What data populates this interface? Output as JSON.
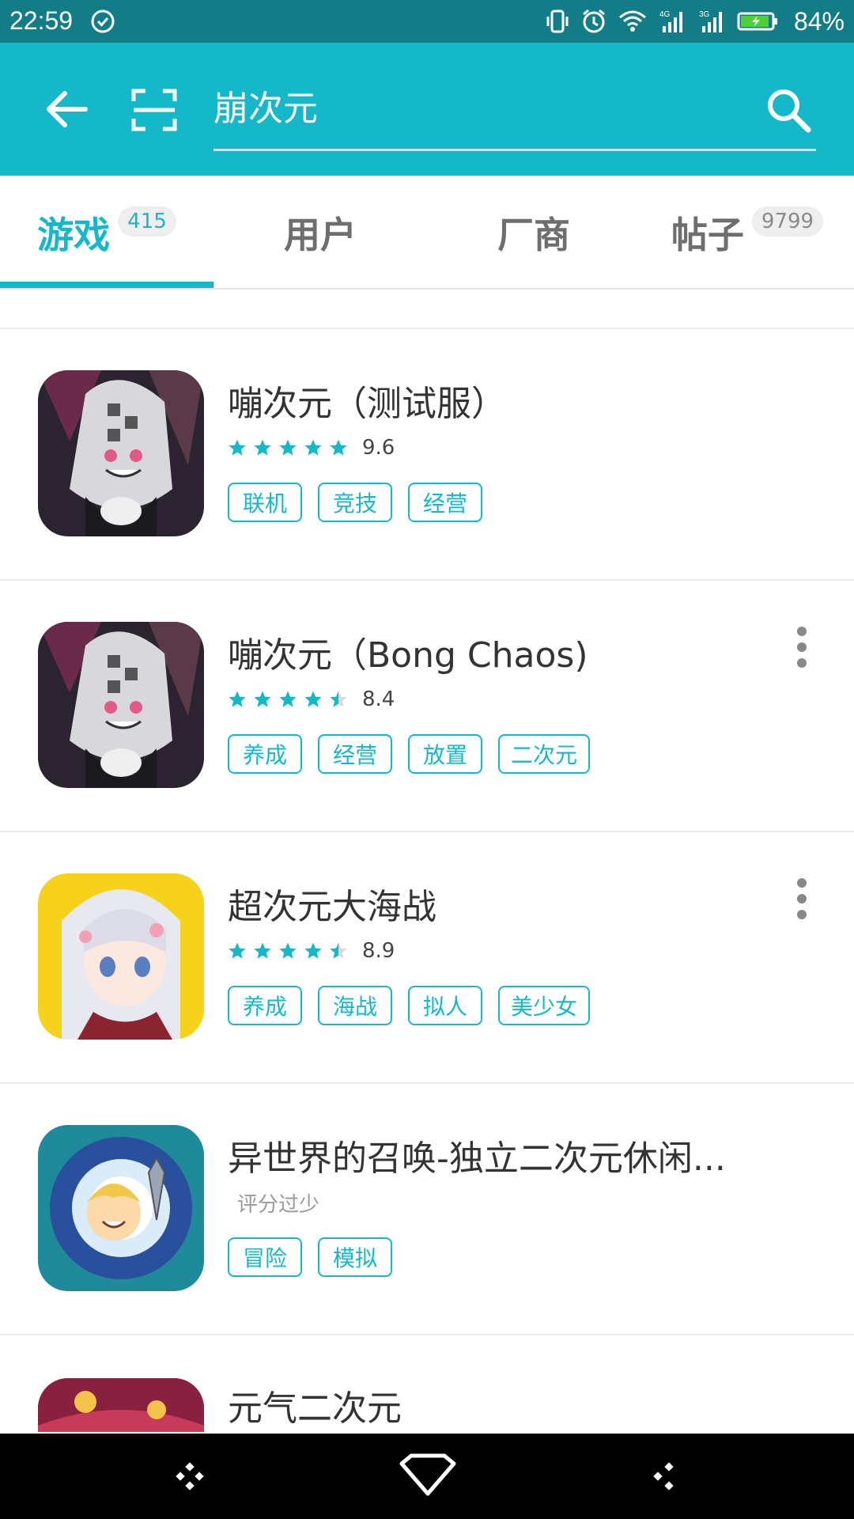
{
  "status_bar": {
    "time": "22:59",
    "battery_percent": "84%",
    "icons": [
      "check-circle-icon",
      "vibrate-icon",
      "alarm-icon",
      "wifi-icon",
      "signal-4g-icon",
      "signal-3g-icon",
      "battery-charging-icon"
    ]
  },
  "toolbar": {
    "search_query": "崩次元",
    "accent_color": "#15b8c9"
  },
  "tabs": [
    {
      "label": "游戏",
      "count": "415",
      "active": true
    },
    {
      "label": "用户",
      "count": "",
      "active": false
    },
    {
      "label": "厂商",
      "count": "",
      "active": false
    },
    {
      "label": "帖子",
      "count": "9799",
      "active": false
    }
  ],
  "results": [
    {
      "title": "嘣次元（测试服）",
      "rating": 9.6,
      "score_text": "9.6",
      "stars": 5,
      "tags": [
        "联机",
        "竞技",
        "经营"
      ],
      "has_menu": false
    },
    {
      "title": "嘣次元（Bong Chaos)",
      "rating": 8.4,
      "score_text": "8.4",
      "stars": 4.5,
      "tags": [
        "养成",
        "经营",
        "放置",
        "二次元"
      ],
      "has_menu": true
    },
    {
      "title": "超次元大海战",
      "rating": 8.9,
      "score_text": "8.9",
      "stars": 4.5,
      "tags": [
        "养成",
        "海战",
        "拟人",
        "美少女"
      ],
      "has_menu": true
    },
    {
      "title": "异世界的召唤-独立二次元休闲...",
      "score_text": "",
      "low_rating_text": "评分过少",
      "tags": [
        "冒险",
        "模拟"
      ],
      "has_menu": false
    },
    {
      "title": "元气二次元",
      "tags": [],
      "has_menu": false
    }
  ]
}
